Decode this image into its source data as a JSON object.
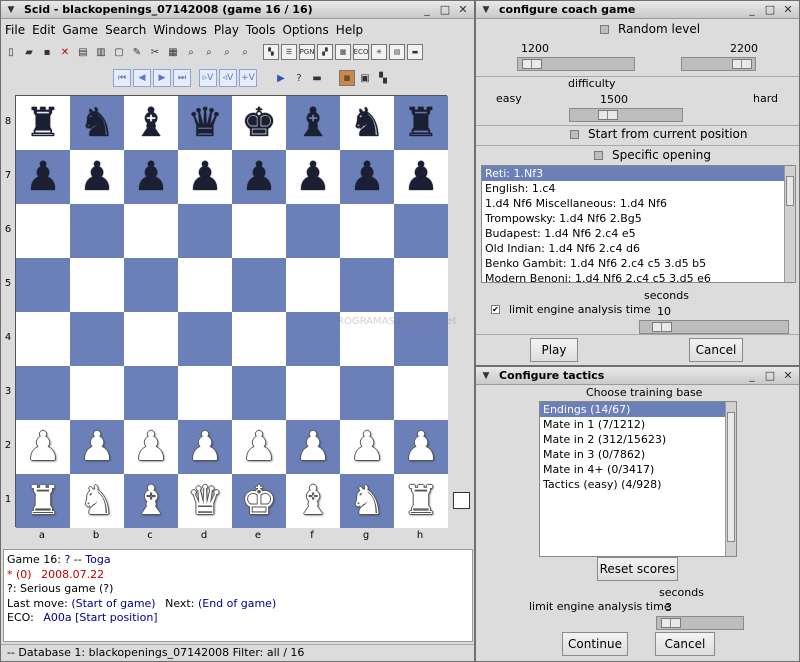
{
  "main_window": {
    "title": "Scid - blackopenings_07142008 (game 16 / 16)",
    "menu": [
      "File",
      "Edit",
      "Game",
      "Search",
      "Windows",
      "Play",
      "Tools",
      "Options",
      "Help"
    ],
    "ranks": [
      "8",
      "7",
      "6",
      "5",
      "4",
      "3",
      "2",
      "1"
    ],
    "files": [
      "a",
      "b",
      "c",
      "d",
      "e",
      "f",
      "g",
      "h"
    ],
    "board": [
      [
        "b:♜",
        "b:♞",
        "b:♝",
        "b:♛",
        "b:♚",
        "b:♝",
        "b:♞",
        "b:♜"
      ],
      [
        "b:♟",
        "b:♟",
        "b:♟",
        "b:♟",
        "b:♟",
        "b:♟",
        "b:♟",
        "b:♟"
      ],
      [
        "",
        "",
        "",
        "",
        "",
        "",
        "",
        ""
      ],
      [
        "",
        "",
        "",
        "",
        "",
        "",
        "",
        ""
      ],
      [
        "",
        "",
        "",
        "",
        "",
        "",
        "",
        ""
      ],
      [
        "",
        "",
        "",
        "",
        "",
        "",
        "",
        ""
      ],
      [
        "w:♟",
        "w:♟",
        "w:♟",
        "w:♟",
        "w:♟",
        "w:♟",
        "w:♟",
        "w:♟"
      ],
      [
        "w:♜",
        "w:♞",
        "w:♝",
        "w:♛",
        "w:♚",
        "w:♝",
        "w:♞",
        "w:♜"
      ]
    ],
    "info": {
      "game_line_prefix": "Game 16:",
      "white": "?",
      "sep": "--",
      "black": "Toga",
      "result_prefix": "*",
      "elo": "(0)",
      "date": "2008.07.22",
      "event": "?:  Serious game  (?)",
      "last_move_label": "Last move:",
      "last_move_value": "(Start of game)",
      "next_label": "Next:",
      "next_value": "(End of game)",
      "eco_label": "ECO:",
      "eco_code": "A00a",
      "eco_desc": "[Start position]"
    },
    "status": "--   Database 1: blackopenings_07142008   Filter: all / 16",
    "watermark": "PROGRAMAS GRATIS .net"
  },
  "coach_window": {
    "title": "configure coach game",
    "random_level": "Random level",
    "level_min": "1200",
    "level_max": "2200",
    "difficulty": "difficulty",
    "easy": "easy",
    "difficulty_value": "1500",
    "hard": "hard",
    "start_current": "Start from current position",
    "specific_opening": "Specific opening",
    "openings": [
      "Reti: 1.Nf3",
      "English: 1.c4",
      "1.d4 Nf6 Miscellaneous: 1.d4 Nf6",
      "Trompowsky: 1.d4 Nf6 2.Bg5",
      "Budapest: 1.d4 Nf6 2.c4 e5",
      "Old Indian: 1.d4 Nf6 2.c4 d6",
      "Benko Gambit: 1.d4 Nf6 2.c4 c5 3.d5 b5",
      "Modern Benoni: 1.d4 Nf6 2.c4 c5 3.d5 e6"
    ],
    "seconds": "seconds",
    "limit_label": "limit engine analysis time",
    "limit_value": "10",
    "play": "Play",
    "cancel": "Cancel"
  },
  "tactics_window": {
    "title": "Configure tactics",
    "choose": "Choose training base",
    "bases": [
      "Endings (14/67)",
      "Mate in 1 (7/1212)",
      "Mate in 2 (312/15623)",
      "Mate in 3 (0/7862)",
      "Mate in 4+ (0/3417)",
      "Tactics (easy) (4/928)"
    ],
    "reset": "Reset scores",
    "seconds": "seconds",
    "limit_label": "limit engine analysis time",
    "limit_value": "3",
    "continue": "Continue",
    "cancel": "Cancel"
  }
}
